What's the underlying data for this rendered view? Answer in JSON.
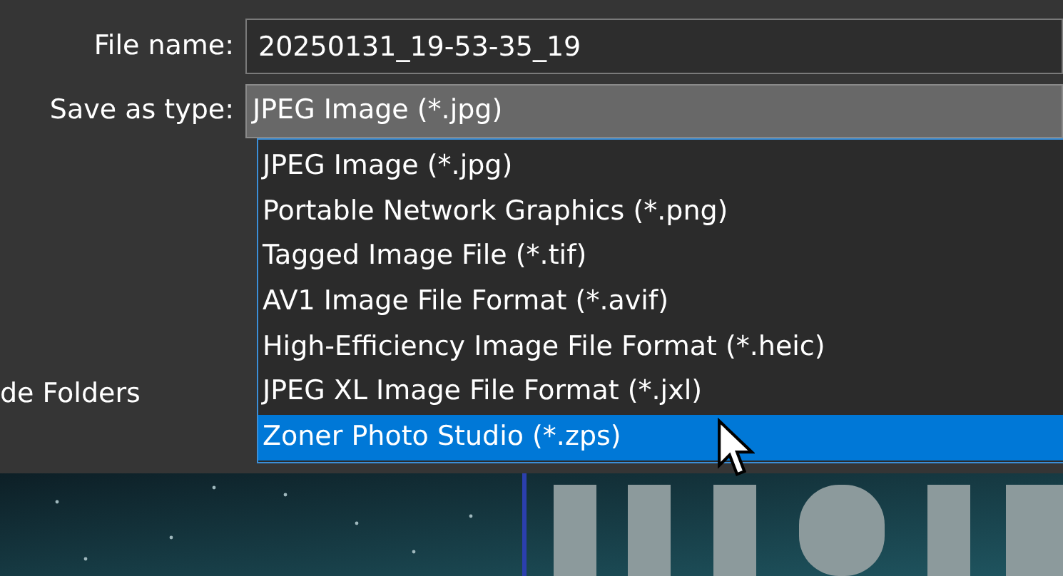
{
  "fields": [
    {
      "label": "File name:",
      "value": "20250131_19-53-35_19"
    }
  ],
  "type_select": {
    "label": "Save as type:",
    "value": "JPEG Image (*.jpg)"
  },
  "type_options": [
    {
      "label": "JPEG Image (*.jpg)",
      "selected": false
    },
    {
      "label": "Portable Network Graphics (*.png)",
      "selected": false
    },
    {
      "label": "Tagged Image File (*.tif)",
      "selected": false
    },
    {
      "label": "AV1 Image File Format (*.avif)",
      "selected": false
    },
    {
      "label": "High-Efficiency Image File Format (*.heic)",
      "selected": false
    },
    {
      "label": "JPEG XL Image File Format (*.jxl)",
      "selected": false
    },
    {
      "label": "Zoner Photo Studio (*.zps)",
      "selected": true
    }
  ],
  "folders_toggle": {
    "label": "de Folders"
  }
}
